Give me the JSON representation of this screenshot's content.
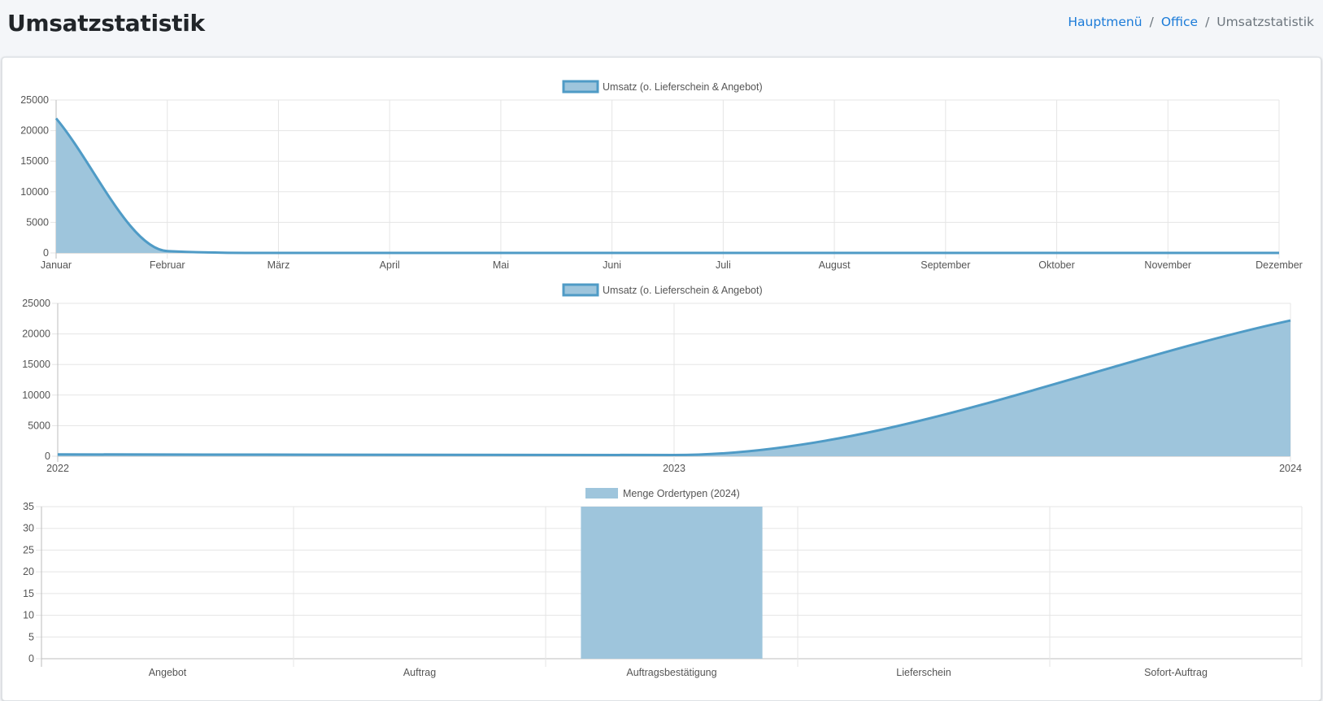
{
  "header": {
    "title": "Umsatzstatistik",
    "breadcrumb": [
      {
        "label": "Hauptmenü",
        "link": true
      },
      {
        "label": "Office",
        "link": true
      },
      {
        "label": "Umsatzstatistik",
        "link": false
      }
    ]
  },
  "colors": {
    "fill": "#9ec5dc",
    "line": "#4f9bc6",
    "grid": "#e5e5e5",
    "axis": "#bdbdbd",
    "tick_text": "#555555"
  },
  "chart_data": [
    {
      "type": "area",
      "legend": "Umsatz (o. Lieferschein & Angebot)",
      "categories": [
        "Januar",
        "Februar",
        "März",
        "April",
        "Mai",
        "Juni",
        "Juli",
        "August",
        "September",
        "Oktober",
        "November",
        "Dezember"
      ],
      "values": [
        22000,
        300,
        0,
        0,
        0,
        0,
        0,
        0,
        0,
        0,
        0,
        0
      ],
      "ylim": [
        0,
        25000
      ],
      "yticks": [
        25000,
        20000,
        15000,
        10000,
        5000,
        0
      ],
      "grid": true,
      "legend_position": "top"
    },
    {
      "type": "area",
      "legend": "Umsatz (o. Lieferschein & Angebot)",
      "categories": [
        "2022",
        "2023",
        "2024"
      ],
      "values": [
        300,
        200,
        22200
      ],
      "ylim": [
        0,
        25000
      ],
      "yticks": [
        25000,
        20000,
        15000,
        10000,
        5000,
        0
      ],
      "grid": true,
      "legend_position": "top"
    },
    {
      "type": "bar",
      "legend": "Menge Ordertypen (2024)",
      "categories": [
        "Angebot",
        "Auftrag",
        "Auftragsbestätigung",
        "Lieferschein",
        "Sofort-Auftrag"
      ],
      "values": [
        0,
        0,
        35,
        0,
        0
      ],
      "ylim": [
        0,
        35
      ],
      "yticks": [
        35,
        30,
        25,
        20,
        15,
        10,
        5,
        0
      ],
      "grid": true,
      "legend_position": "top"
    }
  ]
}
